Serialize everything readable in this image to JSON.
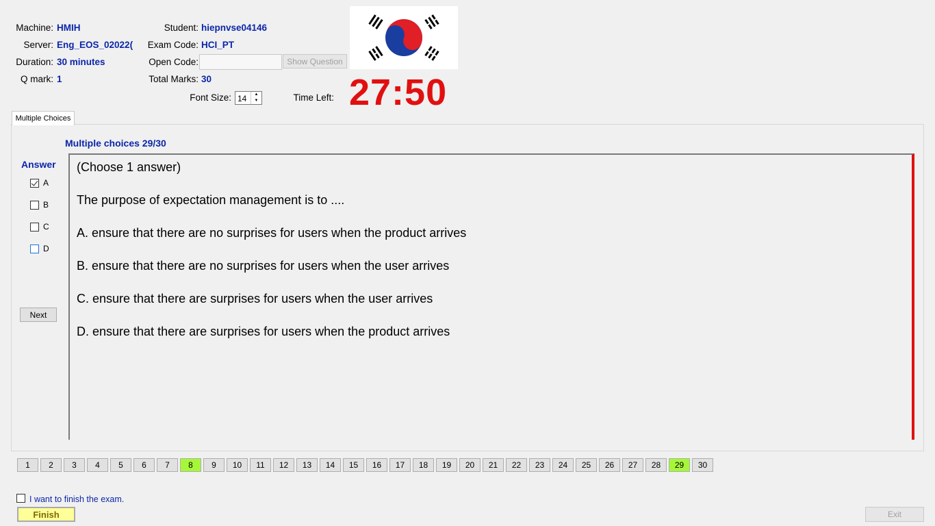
{
  "header": {
    "machine_label": "Machine:",
    "machine_value": "HMIH",
    "server_label": "Server:",
    "server_value": "Eng_EOS_02022(",
    "duration_label": "Duration:",
    "duration_value": "30 minutes",
    "qmark_label": "Q mark:",
    "qmark_value": "1",
    "student_label": "Student:",
    "student_value": "hiepnvse04146",
    "exam_code_label": "Exam Code:",
    "exam_code_value": "HCI_PT",
    "open_code_label": "Open Code:",
    "open_code_value": "",
    "show_question_label": "Show Question",
    "total_marks_label": "Total Marks:",
    "total_marks_value": "30",
    "font_size_label": "Font Size:",
    "font_size_value": "14",
    "time_left_label": "Time Left:",
    "time_left_value": "27:50"
  },
  "tab": {
    "label": "Multiple Choices"
  },
  "section_title": "Multiple choices 29/30",
  "answer": {
    "title": "Answer",
    "options": [
      {
        "label": "A",
        "checked": true
      },
      {
        "label": "B",
        "checked": false
      },
      {
        "label": "C",
        "checked": false
      },
      {
        "label": "D",
        "checked": false
      }
    ],
    "next_label": "Next"
  },
  "question": {
    "lines": [
      "(Choose 1 answer)",
      "The purpose of expectation management is to ....",
      "A.  ensure that there are no surprises for users when the product arrives",
      "B.  ensure that there are no surprises for users when the user arrives",
      "C.  ensure that there are surprises for users when the user arrives",
      "D.  ensure that there are surprises for users when the product arrives"
    ]
  },
  "navigation": {
    "questions": [
      "1",
      "2",
      "3",
      "4",
      "5",
      "6",
      "7",
      "8",
      "9",
      "10",
      "11",
      "12",
      "13",
      "14",
      "15",
      "16",
      "17",
      "18",
      "19",
      "20",
      "21",
      "22",
      "23",
      "24",
      "25",
      "26",
      "27",
      "28",
      "29",
      "30"
    ],
    "answered": [
      "8",
      "29"
    ]
  },
  "footer": {
    "finish_checkbox_label": "I want to finish the exam.",
    "finish_label": "Finish",
    "exit_label": "Exit"
  },
  "colors": {
    "accent": "#0b26a8",
    "timer": "#e11010",
    "answered": "#a6f73a"
  }
}
